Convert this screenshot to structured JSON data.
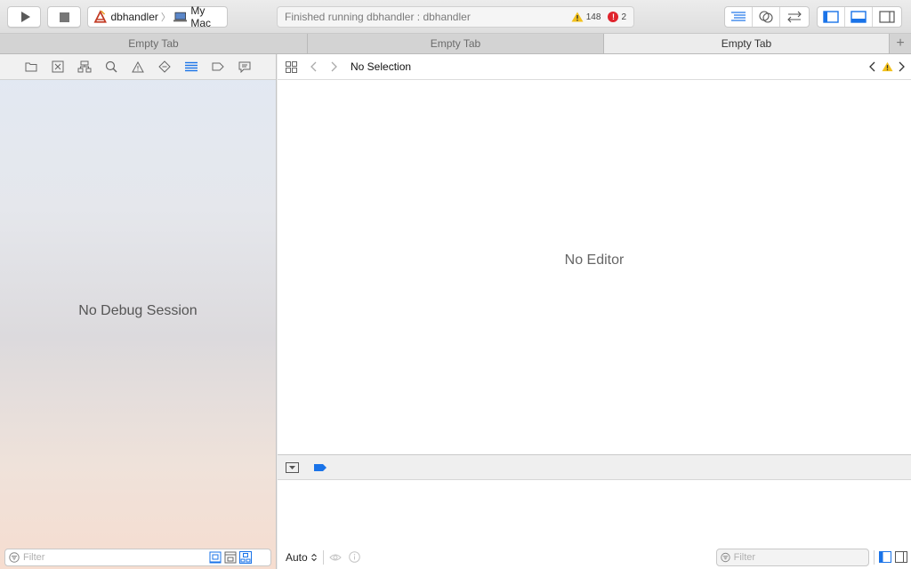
{
  "toolbar": {
    "run_label": "Run",
    "stop_label": "Stop",
    "scheme": {
      "target": "dbhandler",
      "destination": "My Mac"
    },
    "activity": {
      "status": "Finished running dbhandler : dbhandler",
      "warnings": "148",
      "errors": "2"
    },
    "editor_modes": [
      "standard-editor-icon",
      "assistant-editor-icon",
      "version-editor-icon"
    ],
    "view_toggles": [
      "navigator-toggle-icon",
      "debug-area-toggle-icon",
      "utilities-toggle-icon"
    ]
  },
  "tabs": [
    {
      "label": "Empty Tab",
      "active": false
    },
    {
      "label": "Empty Tab",
      "active": false
    },
    {
      "label": "Empty Tab",
      "active": true
    }
  ],
  "navigator": {
    "tab_icons": [
      "folder-icon",
      "source-control-icon",
      "hierarchy-icon",
      "search-icon",
      "warning-icon",
      "test-icon",
      "debug-icon",
      "breakpoint-icon",
      "report-icon"
    ],
    "active_tab": "debug-icon",
    "empty_message": "No Debug Session",
    "filter_placeholder": "Filter"
  },
  "editor": {
    "jump_title": "No Selection",
    "empty_message": "No Editor"
  },
  "debug_area": {
    "variables_mode": "Auto",
    "filter_placeholder": "Filter"
  },
  "colors": {
    "accent": "#1a73e8",
    "warning": "#f3c11b",
    "error": "#e0242d"
  }
}
